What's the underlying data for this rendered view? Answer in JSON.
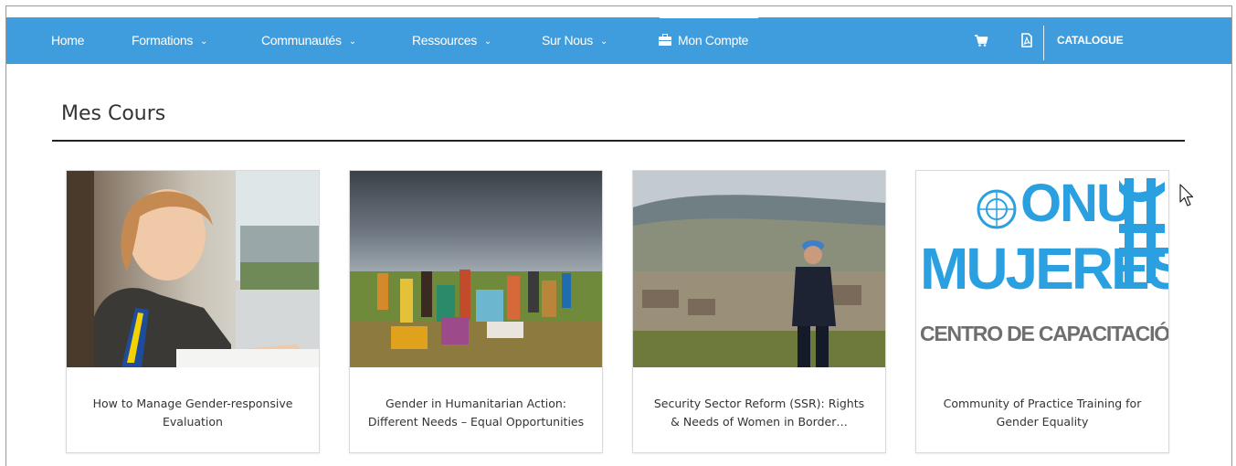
{
  "nav": {
    "items": [
      {
        "label": "Home"
      },
      {
        "label": "Formations"
      },
      {
        "label": "Communautés"
      },
      {
        "label": "Ressources"
      },
      {
        "label": "Sur Nous"
      },
      {
        "label": "Mon Compte"
      }
    ],
    "catalogue_label": "CATALOGUE",
    "cart_icon": "cart-icon",
    "pdf_icon": "pdf-icon",
    "background": "#3f9ddd"
  },
  "page": {
    "title": "Mes Cours"
  },
  "courses": [
    {
      "title": "How to Manage Gender-responsive Evaluation",
      "image": "woman-reading-photo"
    },
    {
      "title": "Gender in Humanitarian Action: Different Needs – Equal Opportunities",
      "image": "people-gathering-field-photo"
    },
    {
      "title": "Security Sector Reform (SSR): Rights & Needs of Women in Border…",
      "image": "un-officer-landscape-photo"
    },
    {
      "title": "Community of Practice Training for Gender Equality",
      "image": "onu-mujeres-logo"
    }
  ],
  "logo": {
    "line1": "ONU",
    "line2": "MUJERES",
    "line3": "CENTRO DE CAPACITACIÓN",
    "color": "#2aa0e0"
  }
}
